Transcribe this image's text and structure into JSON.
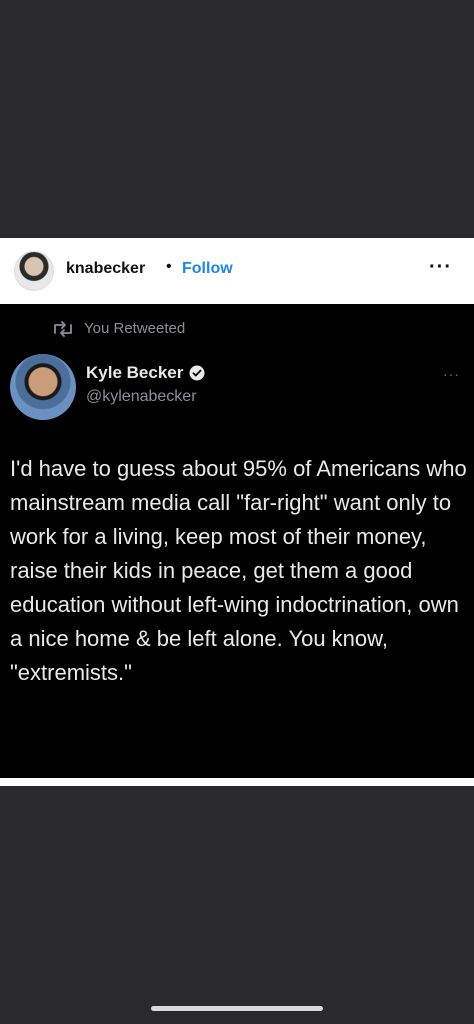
{
  "post": {
    "username": "knabecker",
    "separator": "•",
    "follow_label": "Follow",
    "more_label": "···"
  },
  "tweet": {
    "retweet_label": "You Retweeted",
    "display_name": "Kyle Becker",
    "handle": "@kylenabecker",
    "more_label": "···",
    "text": "I'd have to guess about 95% of Americans who mainstream media call \"far-right\" want only to work for a living, keep most of their money, raise their kids in peace, get them a good education without left-wing indoctrination, own a nice home & be left alone. You know, \"extremists.\""
  },
  "colors": {
    "follow": "#1e88e5",
    "tweet_bg": "#000000",
    "tweet_text": "#e7e9ea",
    "muted": "#8b8f94"
  }
}
